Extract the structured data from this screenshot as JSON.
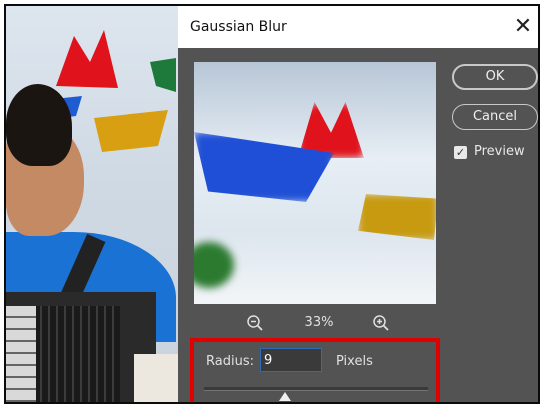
{
  "dialog": {
    "title": "Gaussian Blur",
    "close_glyph": "✕",
    "ok_label": "OK",
    "cancel_label": "Cancel",
    "preview_label": "Preview",
    "preview_checked": true,
    "zoom_out_icon": "zoom-out-icon",
    "zoom_in_icon": "zoom-in-icon",
    "zoom_level": "33%",
    "radius": {
      "label": "Radius:",
      "value": "9",
      "units": "Pixels",
      "slider_fraction": 0.36
    }
  },
  "colors": {
    "dialog_bg": "#535353",
    "highlight_box": "#e00000",
    "input_border": "#2e6bb8"
  }
}
